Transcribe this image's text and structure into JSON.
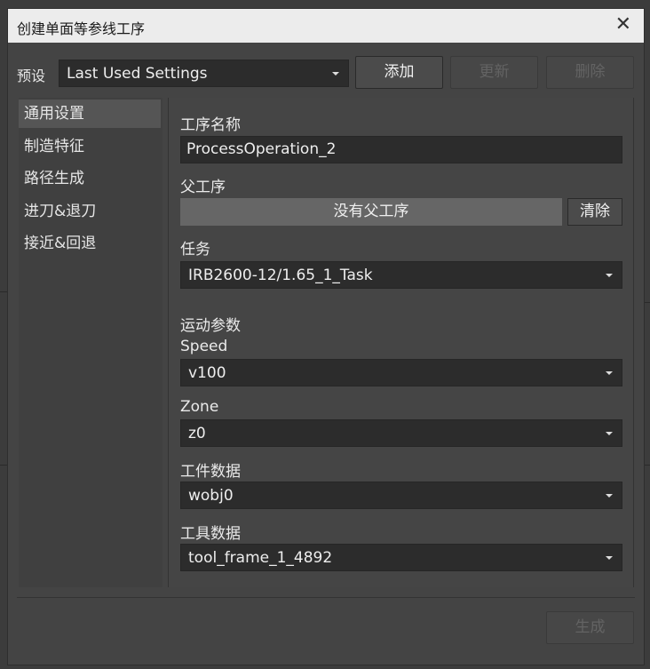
{
  "window": {
    "title": "创建单面等参线工序",
    "close_glyph": "✕"
  },
  "preset": {
    "label": "预设",
    "value": "Last Used Settings",
    "add_label": "添加",
    "update_label": "更新",
    "delete_label": "删除"
  },
  "nav": {
    "items": [
      {
        "label": "通用设置",
        "active": true
      },
      {
        "label": "制造特征",
        "active": false
      },
      {
        "label": "路径生成",
        "active": false
      },
      {
        "label": "进刀&退刀",
        "active": false
      },
      {
        "label": "接近&回退",
        "active": false
      }
    ]
  },
  "form": {
    "operation_name_label": "工序名称",
    "operation_name_value": "ProcessOperation_2",
    "parent_label": "父工序",
    "parent_value": "没有父工序",
    "clear_label": "清除",
    "task_label": "任务",
    "task_value": "IRB2600-12/1.65_1_Task",
    "motion_params_label": "运动参数",
    "speed_label": "Speed",
    "speed_value": "v100",
    "zone_label": "Zone",
    "zone_value": "z0",
    "workobj_label": "工件数据",
    "workobj_value": "wobj0",
    "tool_label": "工具数据",
    "tool_value": "tool_frame_1_4892"
  },
  "footer": {
    "generate_label": "生成"
  }
}
